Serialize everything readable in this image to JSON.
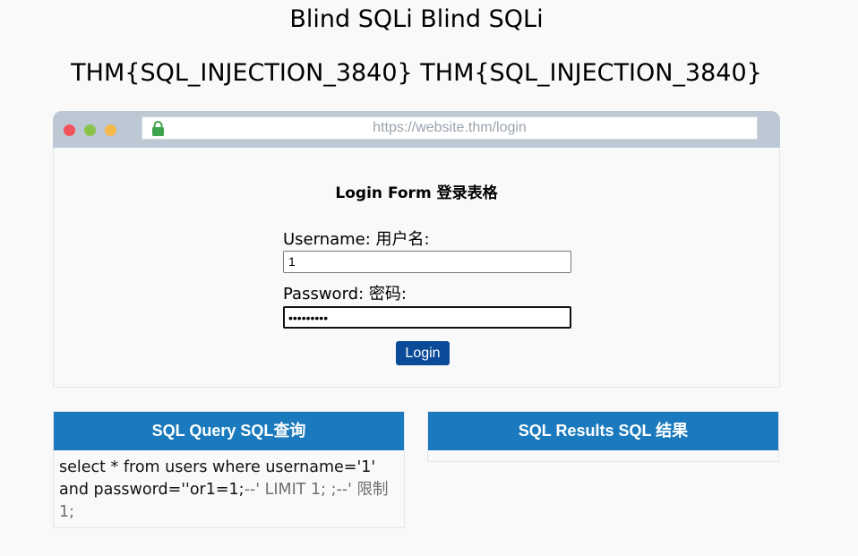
{
  "page": {
    "title": "Blind SQLi Blind SQLi",
    "flag": "THM{SQL_INJECTION_3840} THM{SQL_INJECTION_3840}"
  },
  "browser": {
    "url": "https://website.thm/login",
    "lock_icon": "lock-icon",
    "dot_colors": [
      "#f2545b",
      "#8bc34a",
      "#f6b94b"
    ]
  },
  "form": {
    "title": "Login Form 登录表格",
    "username_label": "Username: 用户名:",
    "username_value": "1",
    "password_label": "Password: 密码:",
    "password_value": "•••••••••",
    "login_button": "Login"
  },
  "query_panel": {
    "title": "SQL Query SQL查询",
    "query_main": "select * from users where username='1' and password=''or1=1;",
    "query_comment": "--' LIMIT 1; ;--' 限制 1;"
  },
  "results_panel": {
    "title": "SQL Results SQL 结果"
  },
  "colors": {
    "accent": "#1a7abd",
    "button": "#0b4a98",
    "browser_bar": "#bcc8d3"
  }
}
